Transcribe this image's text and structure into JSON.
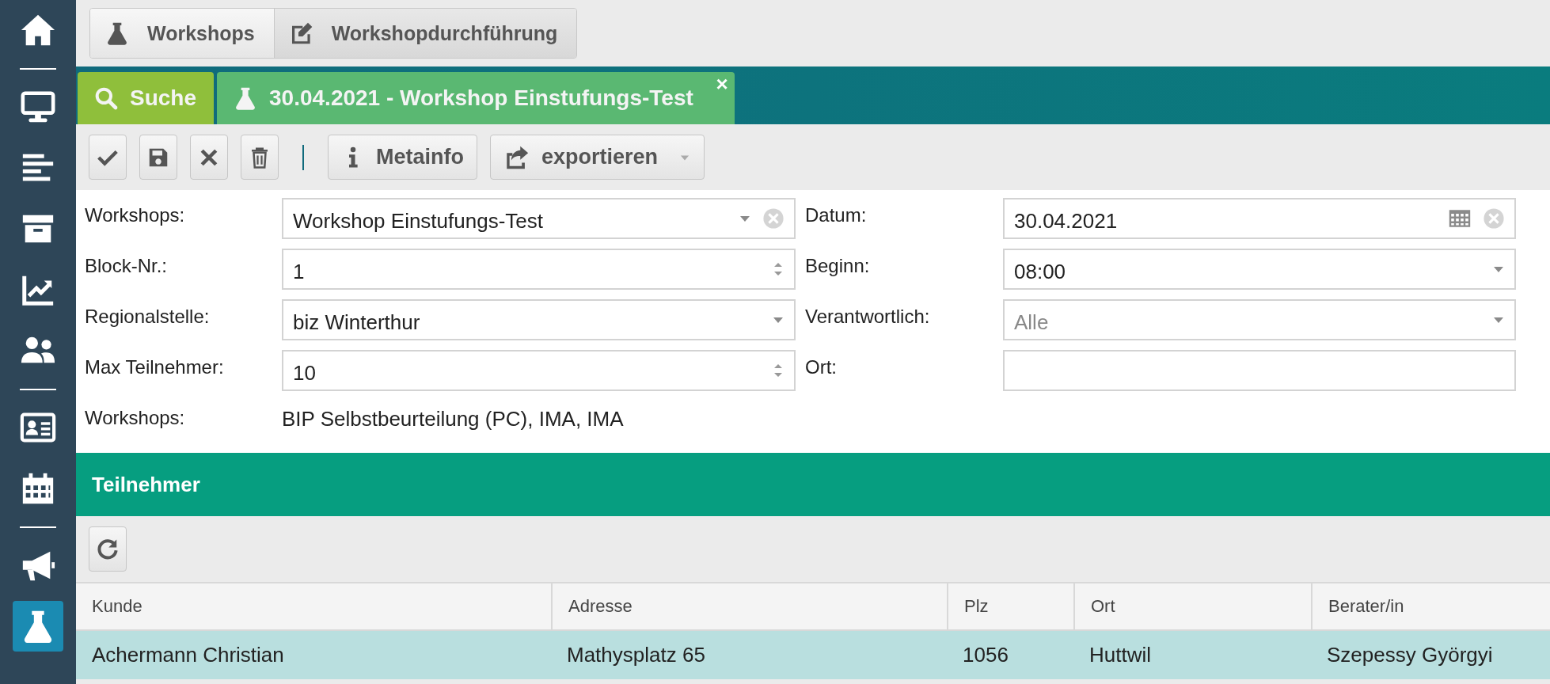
{
  "sidebar": {
    "items": [
      {
        "kind": "button",
        "selected": false
      },
      {
        "kind": "divider"
      },
      {
        "kind": "button",
        "selected": false
      },
      {
        "kind": "button",
        "selected": false
      },
      {
        "kind": "button",
        "selected": false
      },
      {
        "kind": "button",
        "selected": false
      },
      {
        "kind": "button",
        "selected": false
      },
      {
        "kind": "divider"
      },
      {
        "kind": "button",
        "selected": false
      },
      {
        "kind": "button",
        "selected": false
      },
      {
        "kind": "divider"
      },
      {
        "kind": "button",
        "selected": false
      },
      {
        "kind": "button",
        "selected": true
      }
    ]
  },
  "breadcrumbs": [
    "Workshops",
    "Workshopdurchführung"
  ],
  "tabs": [
    {
      "kind": "search",
      "label": "Suche",
      "selected": false
    },
    {
      "kind": "record",
      "label": "30.04.2021 - Workshop Einstufungs-Test",
      "selected": true,
      "close": "×"
    }
  ],
  "toolbar": [
    {
      "kind": "icon"
    },
    {
      "kind": "icon"
    },
    {
      "kind": "icon"
    },
    {
      "kind": "icon"
    },
    {
      "kind": "separator"
    },
    {
      "kind": "text",
      "label": "Metainfo"
    },
    {
      "kind": "menu",
      "label": "exportieren"
    }
  ],
  "form": {
    "left": [
      {
        "label": "Workshops:",
        "kind": "combo",
        "value": "Workshop Einstufungs-Test"
      },
      {
        "label": "Block-Nr.:",
        "kind": "spinner",
        "value": "1"
      },
      {
        "label": "Regionalstelle:",
        "kind": "select",
        "value": "biz Winterthur"
      },
      {
        "label": "Max Teilnehmer:",
        "kind": "spinner",
        "value": "10"
      },
      {
        "label": "Workshops:",
        "kind": "static",
        "value": "BIP Selbstbeurteilung (PC), IMA, IMA"
      }
    ],
    "right": [
      {
        "label": "Datum:",
        "kind": "date",
        "value": "30.04.2021"
      },
      {
        "label": "Beginn:",
        "kind": "select",
        "value": "08:00"
      },
      {
        "label": "Verantwortlich:",
        "kind": "select",
        "placeholder": "Alle"
      },
      {
        "label": "Ort:",
        "kind": "input"
      }
    ]
  },
  "section": {
    "title": "Teilnehmer"
  },
  "table": {
    "columns": [
      "Kunde",
      "Adresse",
      "Plz",
      "Ort",
      "Berater/in"
    ],
    "rows": [
      {
        "cells": [
          "Achermann Christian",
          "Mathysplatz 65",
          "1056",
          "Huttwil",
          "Szepessy Györgyi"
        ],
        "selected": true
      }
    ]
  }
}
